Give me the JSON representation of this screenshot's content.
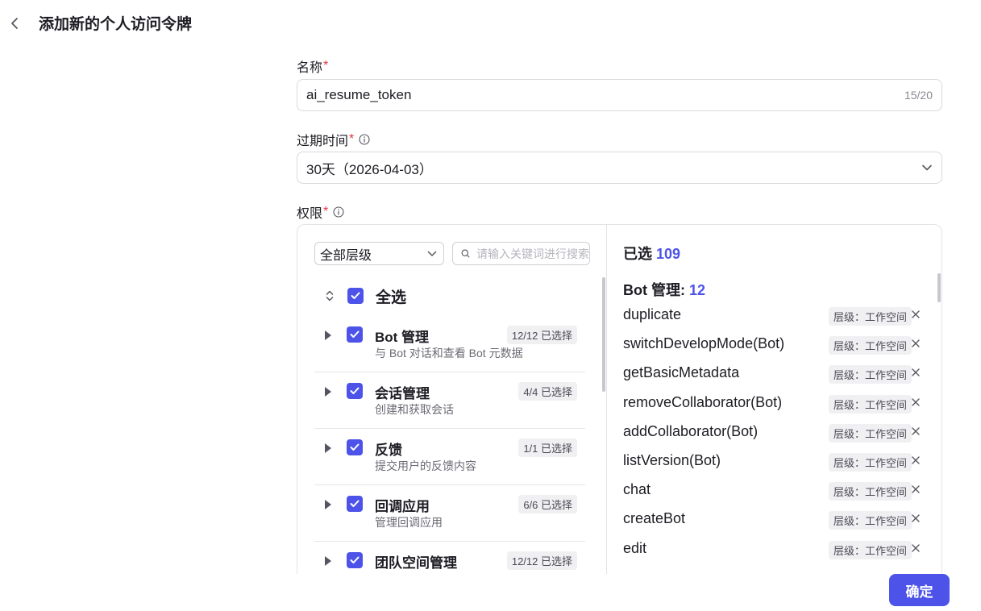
{
  "header": {
    "title": "添加新的个人访问令牌"
  },
  "form": {
    "name": {
      "label": "名称",
      "required_mark": "*",
      "value": "ai_resume_token",
      "counter": "15/20"
    },
    "expire": {
      "label": "过期时间",
      "required_mark": "*",
      "value": "30天（2026-04-03）"
    },
    "permissions": {
      "label": "权限",
      "required_mark": "*"
    }
  },
  "left_pane": {
    "level_filter": "全部层级",
    "search_placeholder": "请输入关键词进行搜索",
    "select_all": "全选",
    "groups": [
      {
        "name": "Bot 管理",
        "desc": "与 Bot 对话和查看 Bot 元数据",
        "badge": "12/12 已选择"
      },
      {
        "name": "会话管理",
        "desc": "创建和获取会话",
        "badge": "4/4 已选择"
      },
      {
        "name": "反馈",
        "desc": "提交用户的反馈内容",
        "badge": "1/1 已选择"
      },
      {
        "name": "回调应用",
        "desc": "管理回调应用",
        "badge": "6/6 已选择"
      },
      {
        "name": "团队空间管理",
        "desc": "",
        "badge": "12/12 已选择"
      }
    ]
  },
  "right_pane": {
    "selected_label": "已选",
    "selected_count": "109",
    "group_label": "Bot 管理:",
    "group_count": "12",
    "items": [
      {
        "name": "duplicate",
        "level": "层级：工作空间"
      },
      {
        "name": "switchDevelopMode(Bot)",
        "level": "层级：工作空间"
      },
      {
        "name": "getBasicMetadata",
        "level": "层级：工作空间"
      },
      {
        "name": "removeCollaborator(Bot)",
        "level": "层级：工作空间"
      },
      {
        "name": "addCollaborator(Bot)",
        "level": "层级：工作空间"
      },
      {
        "name": "listVersion(Bot)",
        "level": "层级：工作空间"
      },
      {
        "name": "chat",
        "level": "层级：工作空间"
      },
      {
        "name": "createBot",
        "level": "层级：工作空间"
      },
      {
        "name": "edit",
        "level": "层级：工作空间"
      }
    ]
  },
  "footer": {
    "confirm": "确定"
  },
  "colors": {
    "accent": "#4d53e8",
    "required": "#e53241"
  }
}
